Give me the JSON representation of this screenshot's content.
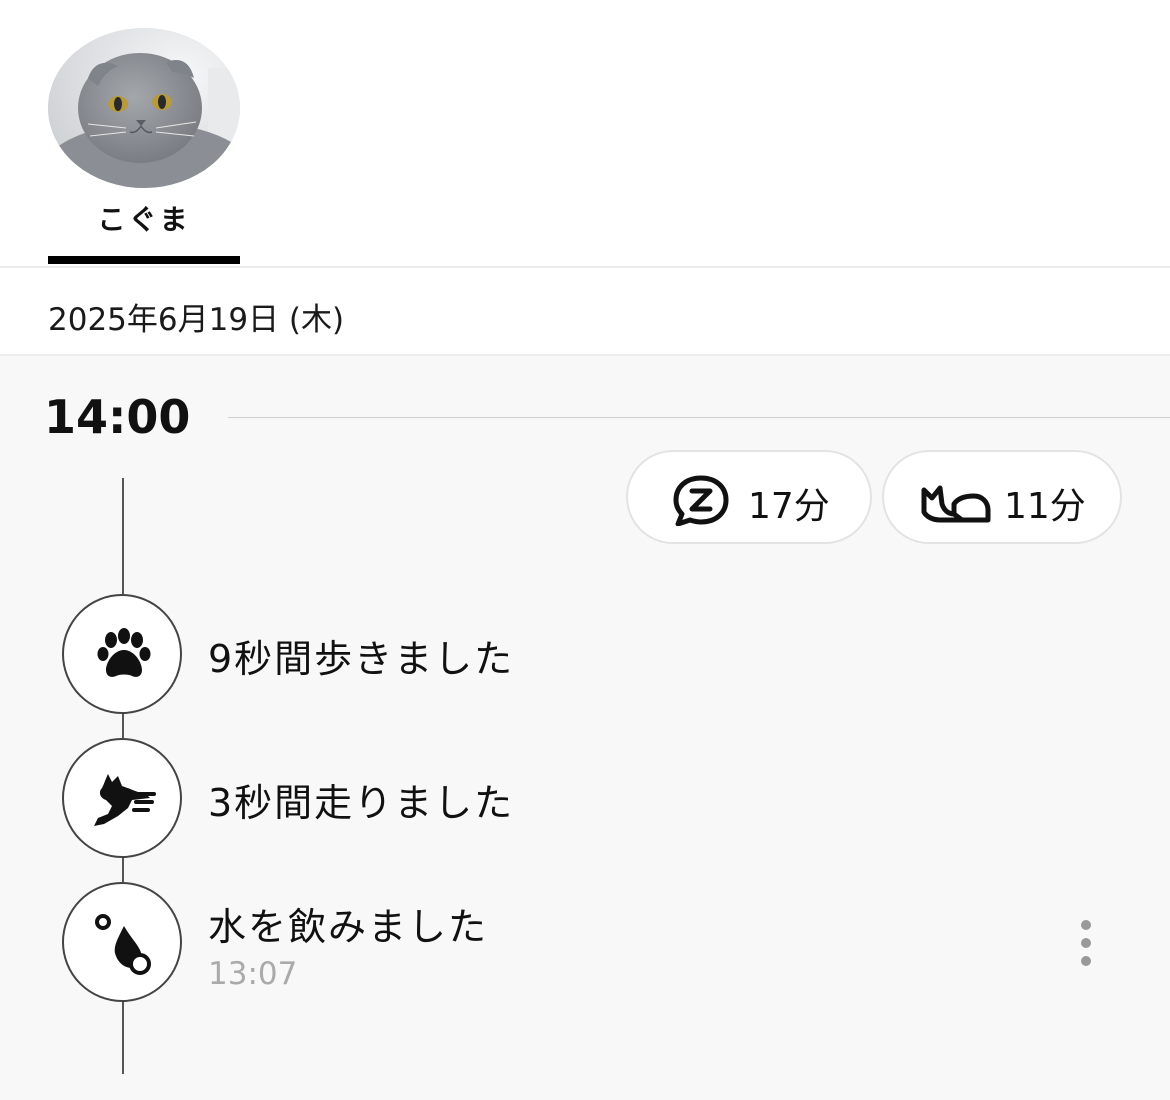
{
  "pet": {
    "name": "こぐま",
    "tab_selected": true
  },
  "date": {
    "label": "2025年6月19日 (木)"
  },
  "timeline": {
    "hour": "14:00",
    "summary": [
      {
        "icon": "sleep-chat-icon",
        "value": "17分"
      },
      {
        "icon": "lying-cat-icon",
        "value": "11分"
      }
    ],
    "events": [
      {
        "icon": "paw-icon",
        "text": "9秒間歩きました",
        "time": ""
      },
      {
        "icon": "running-cat-icon",
        "text": "3秒間走りました",
        "time": ""
      },
      {
        "icon": "water-drop-icon",
        "text": "水を飲みました",
        "time": "13:07"
      }
    ]
  },
  "colors": {
    "tab_indicator": "#000000",
    "timeline_bg": "#f8f8f8",
    "line": "#555555",
    "muted_text": "#aaaaaa"
  }
}
